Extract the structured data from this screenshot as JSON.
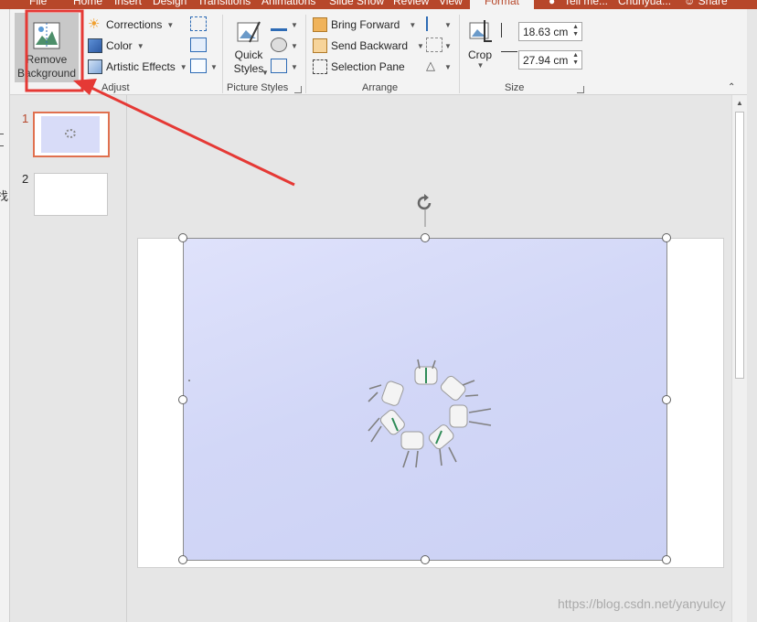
{
  "tabs": [
    {
      "label": "File"
    },
    {
      "label": "Home"
    },
    {
      "label": "Insert"
    },
    {
      "label": "Design"
    },
    {
      "label": "Transitions"
    },
    {
      "label": "Animations"
    },
    {
      "label": "Slide Show"
    },
    {
      "label": "Review"
    },
    {
      "label": "View"
    },
    {
      "label": "Format"
    }
  ],
  "tell_me": "Tell me...",
  "user_name": "Chunyua...",
  "share": "Share",
  "ribbon": {
    "remove_background": "Remove Background",
    "corrections": "Corrections",
    "color": "Color",
    "artistic_effects": "Artistic Effects",
    "adjust": "Adjust",
    "quick_styles": "Quick Styles",
    "picture_styles": "Picture Styles",
    "bring_forward": "Bring Forward",
    "send_backward": "Send Backward",
    "selection_pane": "Selection Pane",
    "arrange": "Arrange",
    "crop": "Crop",
    "height": "18.63 cm",
    "width": "27.94 cm",
    "size": "Size"
  },
  "slides": [
    {
      "number": "1"
    },
    {
      "number": "2"
    }
  ],
  "left_strip_char": "找",
  "watermark": "https://blog.csdn.net/yanyulcy",
  "colors": {
    "accent": "#b7472a",
    "annotation": "#e53935"
  }
}
